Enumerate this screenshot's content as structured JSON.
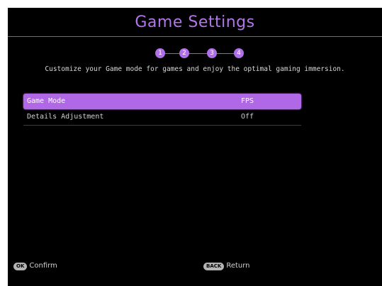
{
  "header": {
    "title": "Game Settings"
  },
  "steps": [
    "1",
    "2",
    "3",
    "4"
  ],
  "description": "Customize your Game mode for games and enjoy the optimal gaming immersion.",
  "menu": {
    "items": [
      {
        "label": "Game Mode",
        "value": "FPS",
        "selected": true
      },
      {
        "label": "Details Adjustment",
        "value": "Off",
        "selected": false
      }
    ]
  },
  "footer": {
    "confirm": {
      "key": "OK",
      "label": "Confirm"
    },
    "return": {
      "key": "BACK",
      "label": "Return"
    }
  },
  "colors": {
    "accent": "#b068e6",
    "background": "#000000",
    "text": "#d0d0d0"
  }
}
